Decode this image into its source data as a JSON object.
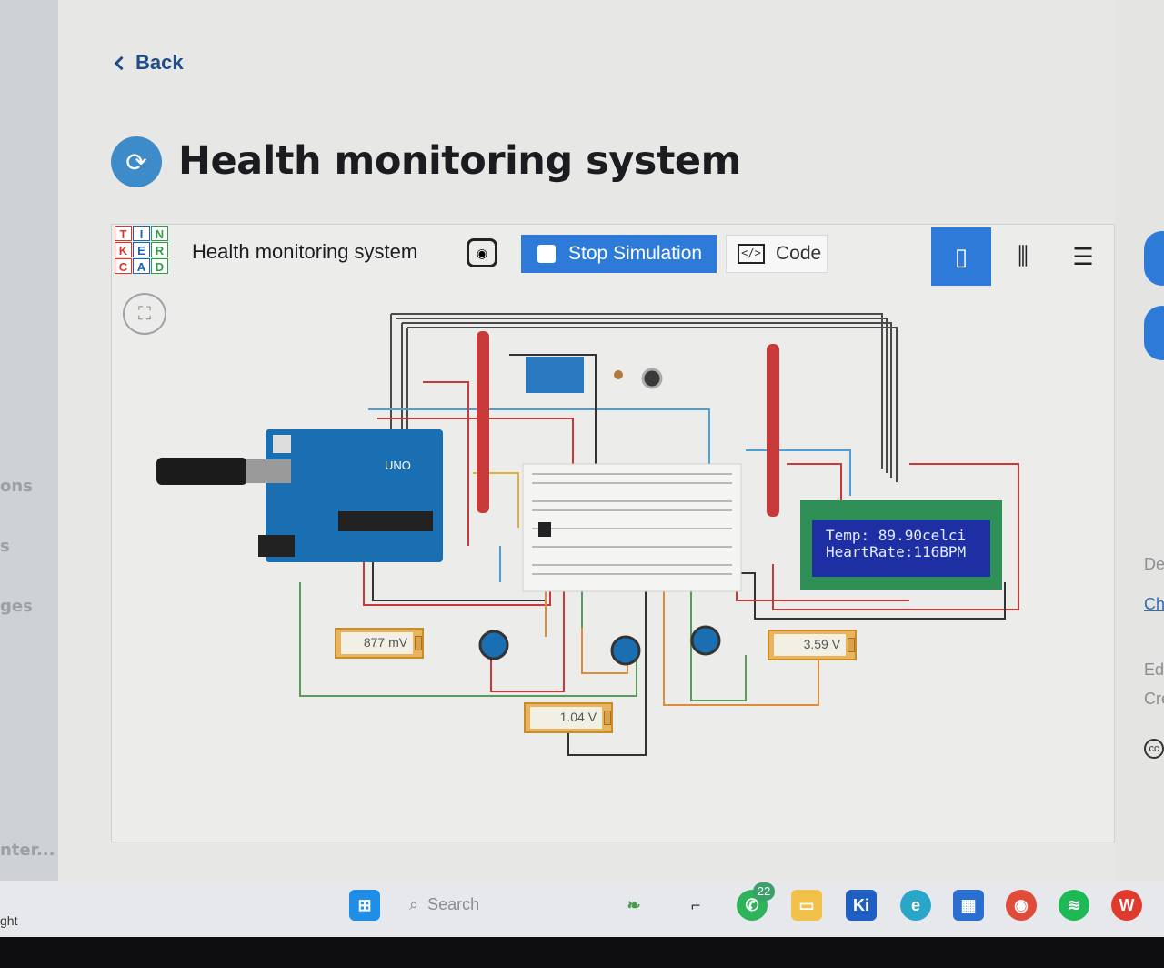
{
  "page": {
    "back_label": "Back",
    "title": "Health monitoring system",
    "left_panel": [
      "ons",
      "s",
      "ges",
      "nter..."
    ],
    "right_edge": {
      "de": "De",
      "ch": "Ch",
      "ed": "Ed",
      "cre": "Cre",
      "cc": "cc"
    }
  },
  "tinkercad": {
    "logo_letters": [
      "T",
      "I",
      "N",
      "K",
      "E",
      "R",
      "C",
      "A",
      "D"
    ],
    "logo_colors": [
      "#e0342a",
      "#1f63b5",
      "#2e9e46",
      "#e0342a",
      "#1f63b5",
      "#2e9e46",
      "#e0342a",
      "#1f63b5",
      "#2e9e46"
    ],
    "project_title": "Health monitoring system",
    "stop_label": "Stop Simulation",
    "code_label": "Code",
    "code_icon": "</>",
    "views": [
      {
        "name": "circuit-view-icon",
        "active": true
      },
      {
        "name": "schematic-view-icon",
        "active": false
      },
      {
        "name": "component-list-icon",
        "active": false
      }
    ],
    "accent": "#2e7ad8"
  },
  "circuit": {
    "arduino_label": "UNO",
    "lcd_line1": "Temp: 89.90celci",
    "lcd_line2": "HeartRate:116BPM",
    "meters": [
      "877 mV",
      "1.04 V",
      "3.59 V"
    ]
  },
  "taskbar": {
    "search_placeholder": "Search",
    "whatsapp_badge": "22",
    "ki_label": "Ki",
    "bottom_left": "ght"
  }
}
